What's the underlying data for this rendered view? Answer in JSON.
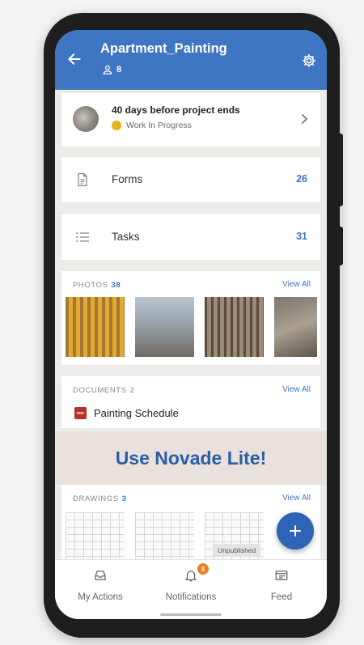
{
  "header": {
    "title": "Apartment_Painting",
    "member_count": "8",
    "back_icon": "arrow-left-icon",
    "settings_icon": "gear-icon"
  },
  "status": {
    "title": "40 days before project ends",
    "state": "Work In Progress",
    "state_color": "#e2b21f"
  },
  "forms": {
    "label": "Forms",
    "count": "26"
  },
  "tasks": {
    "label": "Tasks",
    "count": "31"
  },
  "photos": {
    "label": "PHOTOS",
    "count": "38",
    "view_all": "View All"
  },
  "documents": {
    "label": "DOCUMENTS",
    "count": "2",
    "view_all": "View All",
    "items": [
      {
        "icon_text": "PDF",
        "name": "Painting Schedule"
      }
    ]
  },
  "promo": {
    "text": "Use Novade Lite!"
  },
  "drawings": {
    "label": "DRAWINGS",
    "count": "3",
    "view_all": "View All",
    "badge": "Unpublished"
  },
  "nav": {
    "items": [
      {
        "label": "My Actions",
        "icon": "inbox-icon"
      },
      {
        "label": "Notifications",
        "icon": "bell-icon",
        "badge": "8"
      },
      {
        "label": "Feed",
        "icon": "feed-icon"
      }
    ]
  },
  "colors": {
    "primary": "#3f76c3",
    "badge": "#ef7d22",
    "pdf": "#b4332b"
  }
}
